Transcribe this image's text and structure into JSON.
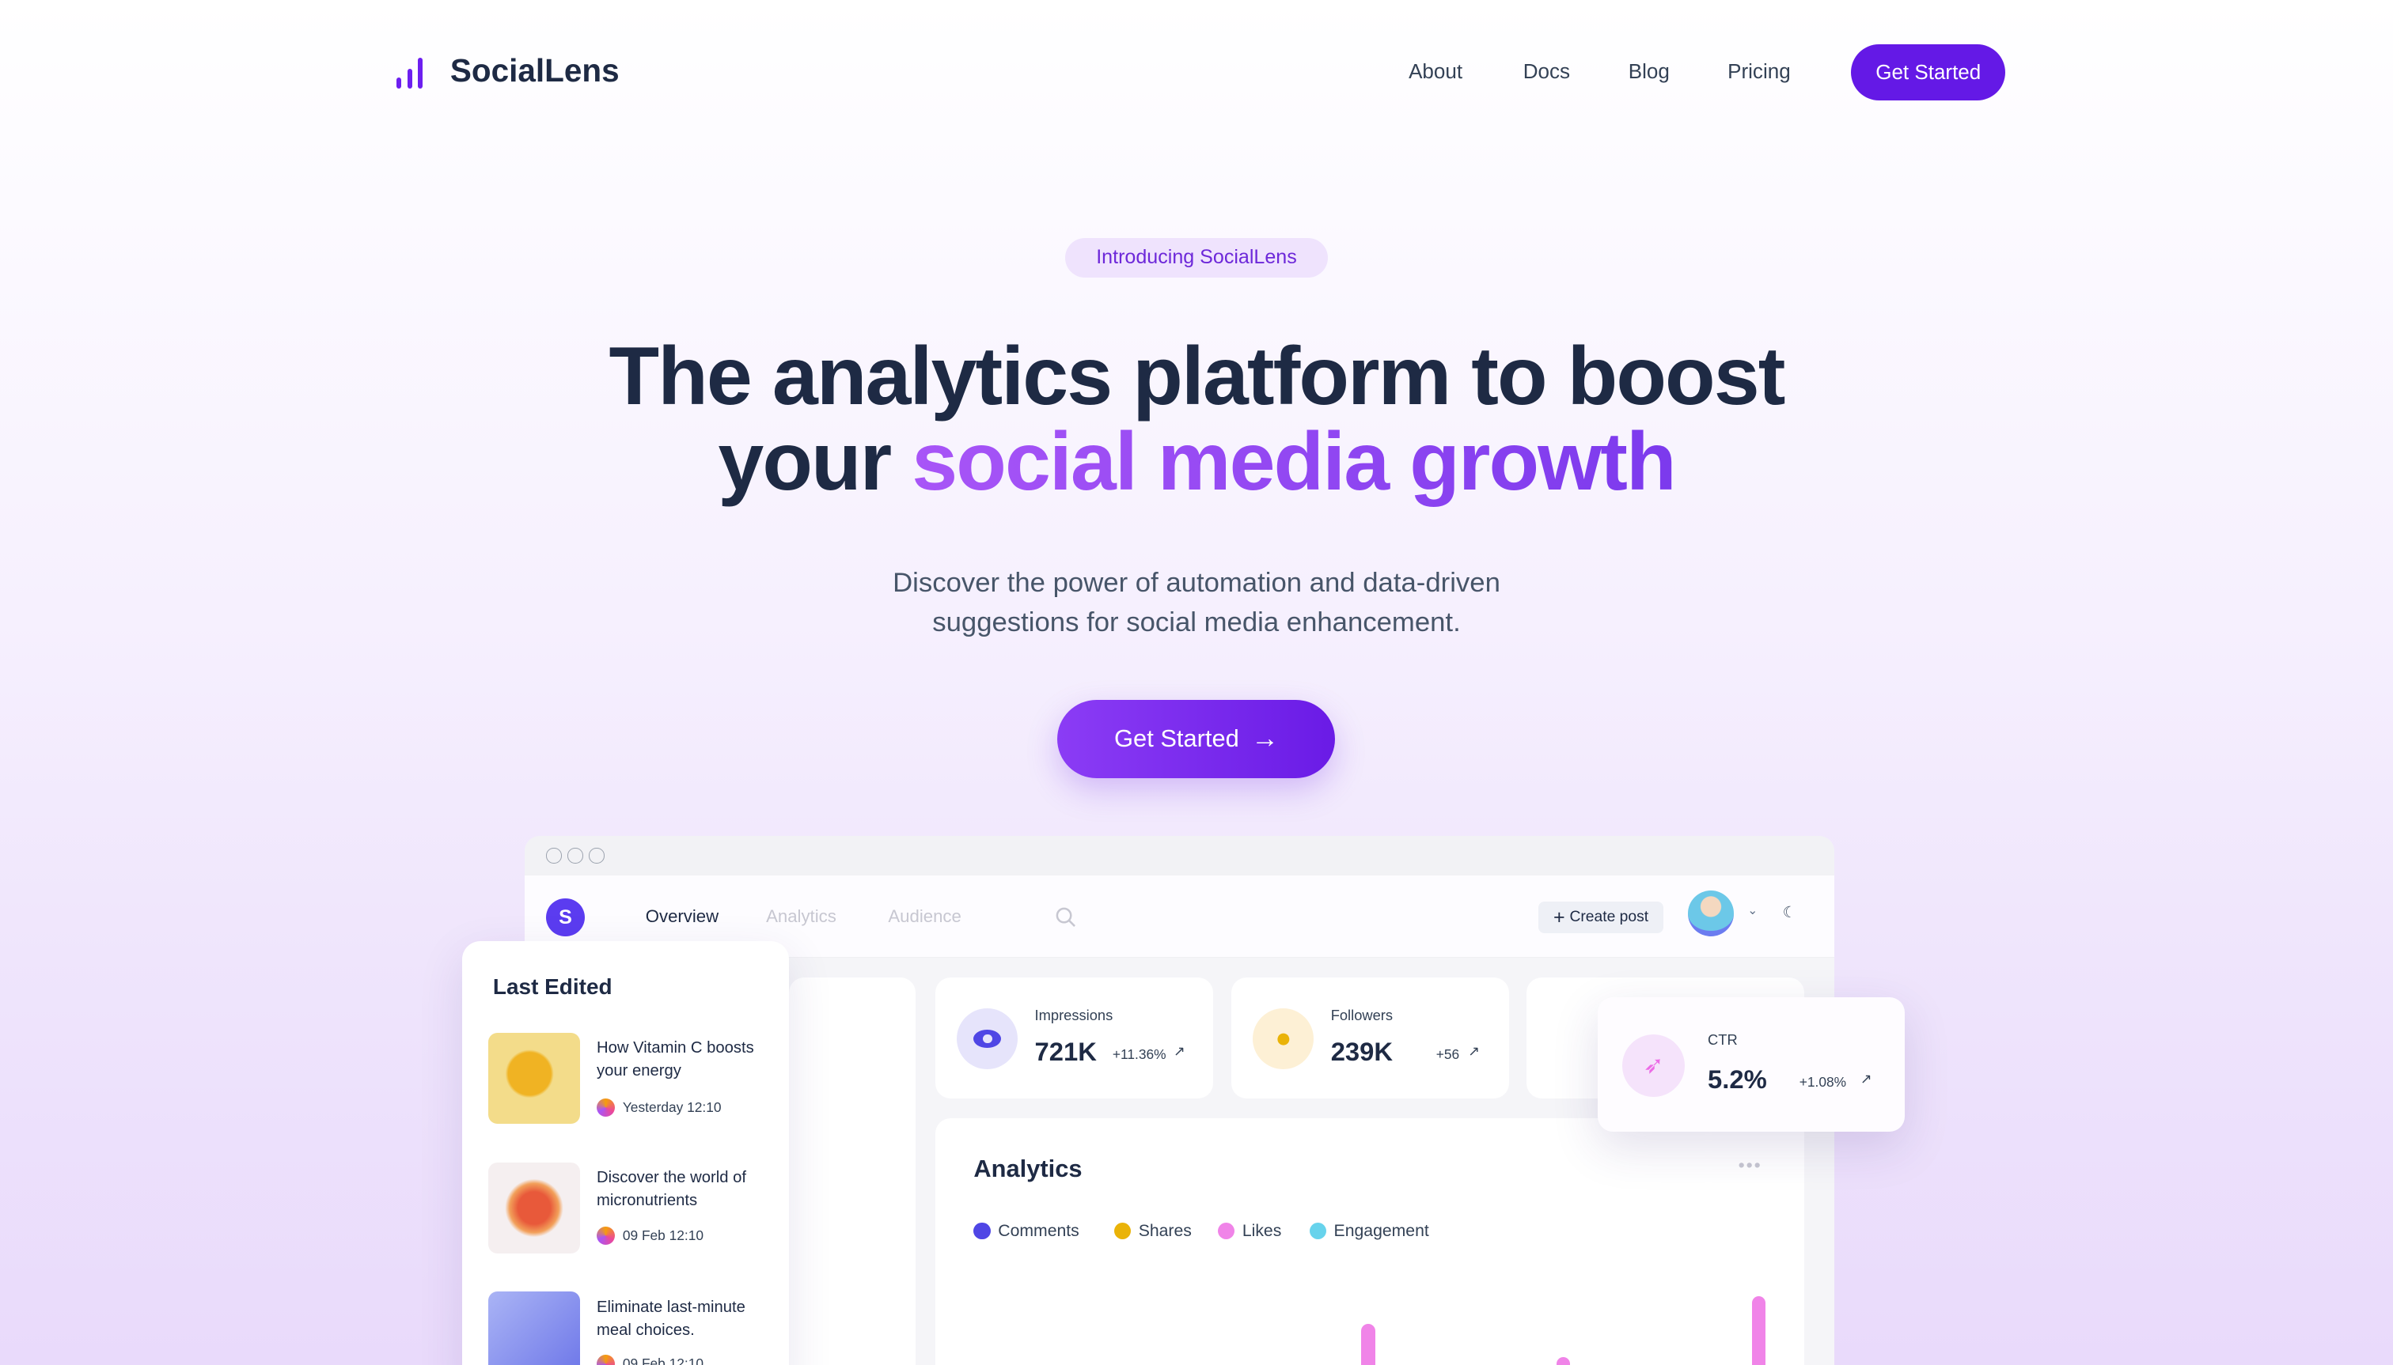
{
  "brand": {
    "name": "SocialLens",
    "accent": "#6419e6"
  },
  "nav": {
    "links": [
      "About",
      "Docs",
      "Blog",
      "Pricing"
    ],
    "cta": "Get Started"
  },
  "hero": {
    "badge": "Introducing SocialLens",
    "title_line1": "The analytics platform to boost",
    "title_line2_plain": "your",
    "title_line2_highlight": "social media growth",
    "subtitle_line1": "Discover the power of automation and data-driven",
    "subtitle_line2": "suggestions for social media enhancement.",
    "cta": "Get Started",
    "cta_icon": "arrow-right-icon"
  },
  "dashboard": {
    "avatar_letter": "S",
    "tabs": [
      "Overview",
      "Analytics",
      "Audience"
    ],
    "create_post": "Create post",
    "stats": [
      {
        "label": "Impressions",
        "value": "721K",
        "change": "+11.36%",
        "icon": "eye-icon"
      },
      {
        "label": "Followers",
        "value": "239K",
        "change": "+56",
        "icon": "user-icon"
      }
    ],
    "ctr": {
      "label": "CTR",
      "value": "5.2%",
      "change": "+1.08%",
      "icon": "cursor-click-icon"
    },
    "analytics": {
      "title": "Analytics",
      "legend": [
        {
          "name": "Comments",
          "color": "#4f46e5"
        },
        {
          "name": "Shares",
          "color": "#eab308"
        },
        {
          "name": "Likes",
          "color": "#f084e8"
        },
        {
          "name": "Engagement",
          "color": "#67d3ec"
        }
      ]
    },
    "last_edited": {
      "title": "Last Edited",
      "items": [
        {
          "title": "How Vitamin C boosts your energy",
          "date": "Yesterday 12:10"
        },
        {
          "title": "Discover the world of micronutrients",
          "date": "09 Feb 12:10"
        },
        {
          "title": "Eliminate last-minute meal choices.",
          "date": "09 Feb 12:10"
        }
      ]
    }
  }
}
